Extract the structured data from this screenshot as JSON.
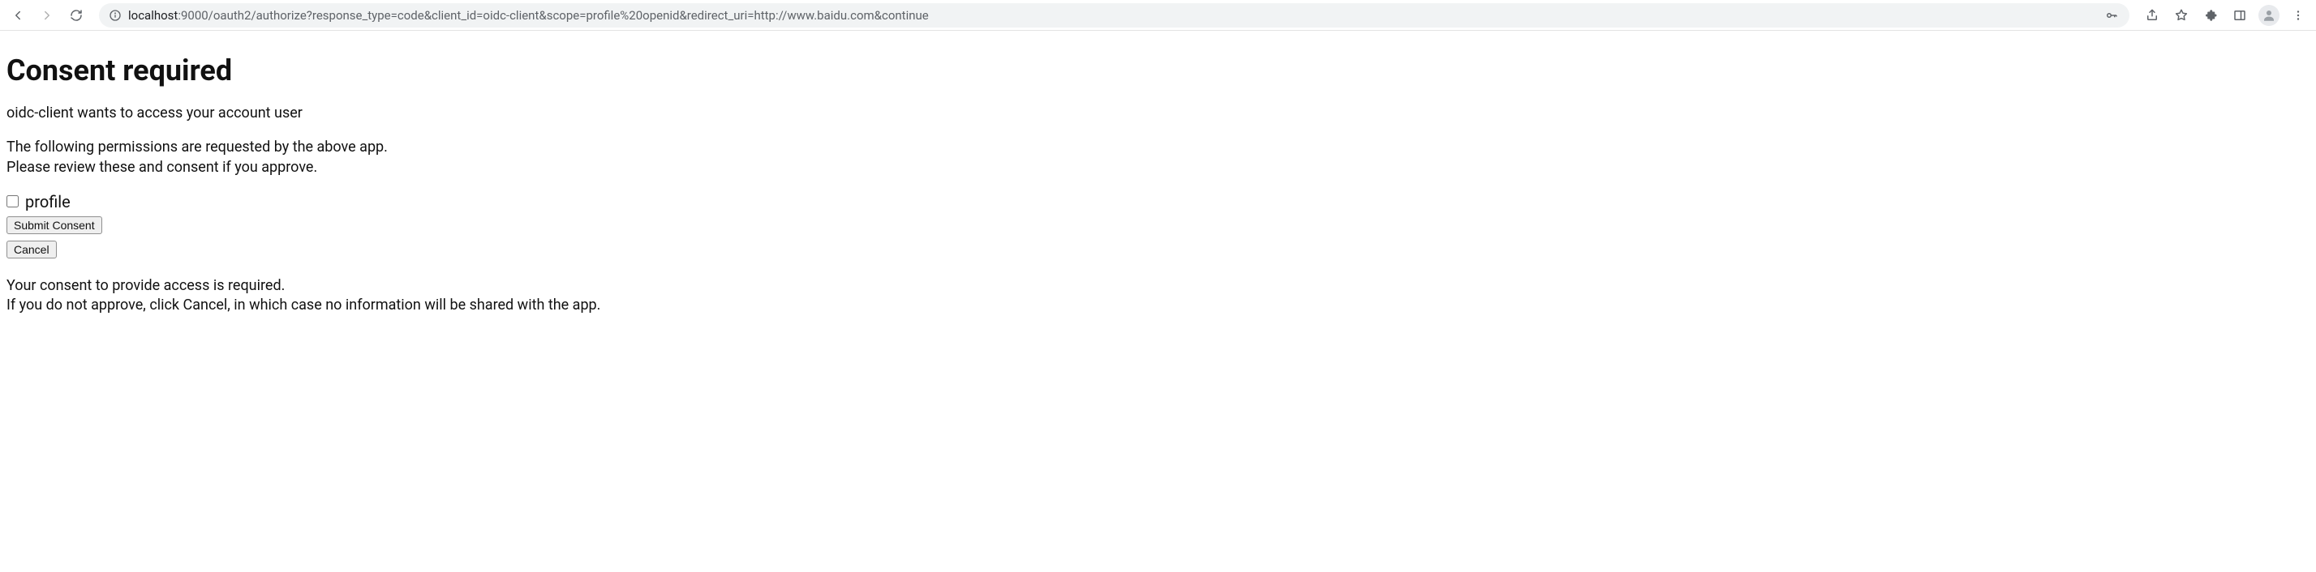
{
  "browser": {
    "url_host": "localhost",
    "url_port_path": ":9000/oauth2/authorize?response_type=code&client_id=oidc-client&scope=profile%20openid&redirect_uri=http://www.baidu.com&continue"
  },
  "page": {
    "title": "Consent required",
    "request_line": "oidc-client wants to access your account user",
    "permissions_intro_line1": "The following permissions are requested by the above app.",
    "permissions_intro_line2": "Please review these and consent if you approve.",
    "scopes": {
      "profile_label": "profile"
    },
    "buttons": {
      "submit": "Submit Consent",
      "cancel": "Cancel"
    },
    "footer_line1": "Your consent to provide access is required.",
    "footer_line2": "If you do not approve, click Cancel, in which case no information will be shared with the app."
  }
}
